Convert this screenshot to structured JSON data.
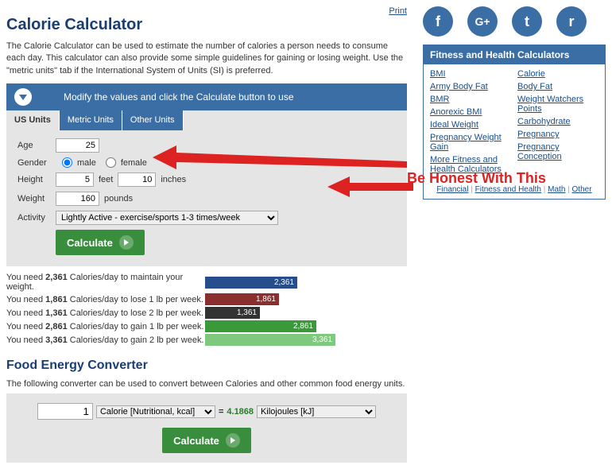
{
  "print_label": "Print",
  "title": "Calorie Calculator",
  "intro": "The Calorie Calculator can be used to estimate the number of calories a person needs to consume each day. This calculator can also provide some simple guidelines for gaining or losing weight. Use the \"metric units\" tab if the International System of Units (SI) is preferred.",
  "bluebar": "Modify the values and click the Calculate button to use",
  "tabs": [
    "US Units",
    "Metric Units",
    "Other Units"
  ],
  "form": {
    "age_label": "Age",
    "age": "25",
    "gender_label": "Gender",
    "male": "male",
    "female": "female",
    "height_label": "Height",
    "ft": "5",
    "ft_unit": "feet",
    "in": "10",
    "in_unit": "inches",
    "weight_label": "Weight",
    "weight": "160",
    "weight_unit": "pounds",
    "activity_label": "Activity",
    "activity": "Lightly Active - exercise/sports 1-3 times/week",
    "calculate": "Calculate"
  },
  "colors": {
    "maintain": "#264e8c",
    "lose1": "#8a2e2e",
    "lose2": "#333",
    "gain1": "#3a9a3a",
    "gain2": "#7fc97f"
  },
  "results": [
    {
      "pre": "You need ",
      "num": "2,361",
      "post": " Calories/day to maintain your weight.",
      "val": 2361,
      "key": "maintain"
    },
    {
      "pre": "You need ",
      "num": "1,861",
      "post": " Calories/day to lose 1 lb per week.",
      "val": 1861,
      "key": "lose1"
    },
    {
      "pre": "You need ",
      "num": "1,361",
      "post": " Calories/day to lose 2 lb per week.",
      "val": 1361,
      "key": "lose2"
    },
    {
      "pre": "You need ",
      "num": "2,861",
      "post": " Calories/day to gain 1 lb per week.",
      "val": 2861,
      "key": "gain1"
    },
    {
      "pre": "You need ",
      "num": "3,361",
      "post": " Calories/day to gain 2 lb per week.",
      "val": 3361,
      "key": "gain2"
    }
  ],
  "max_bar": 3361,
  "conv_title": "Food Energy Converter",
  "conv_intro": "The following converter can be used to convert between Calories and other common food energy units.",
  "conv": {
    "in": "1",
    "from": "Calorie [Nutritional, kcal]",
    "eq": "=",
    "res": "4.1868",
    "to": "Kilojoules [kJ]"
  },
  "sidebar": {
    "socials": [
      "f",
      "G+",
      "t",
      "r"
    ],
    "panel_title": "Fitness and Health Calculators",
    "col1": [
      "BMI",
      "Army Body Fat",
      "BMR",
      "Anorexic BMI",
      "Ideal Weight",
      "Pregnancy Weight Gain",
      "More Fitness and Health Calculators"
    ],
    "col2": [
      "Calorie",
      "Body Fat",
      "Weight Watchers Points",
      "Carbohydrate",
      "Pregnancy",
      "Pregnancy Conception"
    ],
    "cats": [
      "Financial",
      "Fitness and Health",
      "Math",
      "Other"
    ]
  },
  "annotation": "Be Honest With This"
}
